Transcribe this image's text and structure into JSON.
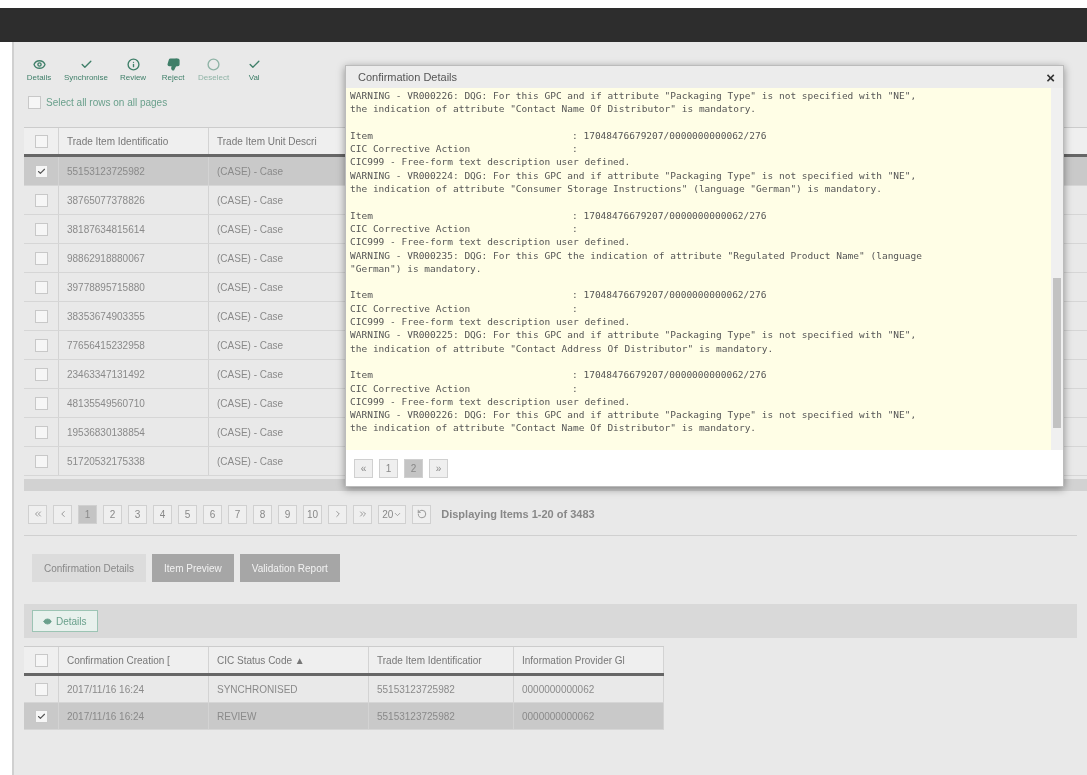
{
  "toolbar": [
    {
      "label": "Details",
      "disabled": false
    },
    {
      "label": "Synchronise",
      "disabled": false
    },
    {
      "label": "Review",
      "disabled": false
    },
    {
      "label": "Reject",
      "disabled": false
    },
    {
      "label": "Deselect",
      "disabled": true
    },
    {
      "label": "Val",
      "disabled": false
    }
  ],
  "select_all": {
    "label": "Select all rows on all pages",
    "checked": false
  },
  "items_table": {
    "header_checked": false,
    "columns": [
      "Trade Item Identificatio",
      "Trade Item Unit Descri"
    ],
    "rows": [
      {
        "cells": [
          "55153123725982",
          "(CASE) - Case"
        ],
        "selected": true
      },
      {
        "cells": [
          "38765077378826",
          "(CASE) - Case"
        ],
        "selected": false
      },
      {
        "cells": [
          "38187634815614",
          "(CASE) - Case"
        ],
        "selected": false
      },
      {
        "cells": [
          "98862918880067",
          "(CASE) - Case"
        ],
        "selected": false
      },
      {
        "cells": [
          "39778895715880",
          "(CASE) - Case"
        ],
        "selected": false
      },
      {
        "cells": [
          "38353674903355",
          "(CASE) - Case"
        ],
        "selected": false
      },
      {
        "cells": [
          "77656415232958",
          "(CASE) - Case"
        ],
        "selected": false
      },
      {
        "cells": [
          "23463347131492",
          "(CASE) - Case"
        ],
        "selected": false
      },
      {
        "cells": [
          "48135549560710",
          "(CASE) - Case"
        ],
        "selected": false
      },
      {
        "cells": [
          "19536830138854",
          "(CASE) - Case"
        ],
        "selected": false
      },
      {
        "cells": [
          "51720532175338",
          "(CASE) - Case"
        ],
        "selected": false
      }
    ]
  },
  "pagination": {
    "pages": [
      {
        "label": "1",
        "selected": true
      },
      {
        "label": "2",
        "selected": false
      },
      {
        "label": "3",
        "selected": false
      },
      {
        "label": "4",
        "selected": false
      },
      {
        "label": "5",
        "selected": false
      },
      {
        "label": "6",
        "selected": false
      },
      {
        "label": "7",
        "selected": false
      },
      {
        "label": "8",
        "selected": false
      },
      {
        "label": "9",
        "selected": false
      },
      {
        "label": "10",
        "selected": false
      }
    ],
    "page_size": "20",
    "status": "Displaying Items 1-20 of 3483"
  },
  "tabs": [
    {
      "label": "Confirmation Details",
      "selected": true
    },
    {
      "label": "Item Preview",
      "selected": false
    },
    {
      "label": "Validation Report",
      "selected": false
    }
  ],
  "details_button": "Details",
  "confirmations_table": {
    "header_checked": false,
    "columns": [
      "Confirmation Creation [",
      "CIC Status Code ▲",
      "Trade Item Identificatior",
      "Information Provider Gl"
    ],
    "rows": [
      {
        "cells": [
          "2017/11/16 16:24",
          "SYNCHRONISED",
          "55153123725982",
          "0000000000062"
        ],
        "selected": false
      },
      {
        "cells": [
          "2017/11/16 16:24",
          "REVIEW",
          "55153123725982",
          "0000000000062"
        ],
        "selected": true
      }
    ]
  },
  "dialog": {
    "title": "Confirmation Details",
    "close": "×",
    "blocks": [
      {
        "lines": [
          "WARNING - VR000226: DQG: For this GPC and if attribute \"Packaging Type\" is not specified with \"NE\",",
          "the indication of attribute \"Contact Name Of Distributor\" is mandatory."
        ]
      },
      {
        "fields": [
          {
            "key": "Item",
            "value": ": 17048476679207/0000000000062/276"
          },
          {
            "key": "CIC Corrective Action",
            "value": ":"
          }
        ],
        "lines": [
          "CIC999 - Free-form text description user defined.",
          "WARNING - VR000224: DQG: For this GPC and if attribute \"Packaging Type\" is not specified with \"NE\",",
          "the indication of attribute \"Consumer Storage Instructions\" (language \"German\") is mandatory."
        ]
      },
      {
        "fields": [
          {
            "key": "Item",
            "value": ": 17048476679207/0000000000062/276"
          },
          {
            "key": "CIC Corrective Action",
            "value": ":"
          }
        ],
        "lines": [
          "CIC999 - Free-form text description user defined.",
          "WARNING - VR000235: DQG: For this GPC the indication of attribute \"Regulated Product Name\" (language",
          "\"German\") is mandatory."
        ]
      },
      {
        "fields": [
          {
            "key": "Item",
            "value": ": 17048476679207/0000000000062/276"
          },
          {
            "key": "CIC Corrective Action",
            "value": ":"
          }
        ],
        "lines": [
          "CIC999 - Free-form text description user defined.",
          "WARNING - VR000225: DQG: For this GPC and if attribute \"Packaging Type\" is not specified with \"NE\",",
          "the indication of attribute \"Contact Address Of Distributor\" is mandatory."
        ]
      },
      {
        "fields": [
          {
            "key": "Item",
            "value": ": 17048476679207/0000000000062/276"
          },
          {
            "key": "CIC Corrective Action",
            "value": ":"
          }
        ],
        "lines": [
          "CIC999 - Free-form text description user defined.",
          "WARNING - VR000226: DQG: For this GPC and if attribute \"Packaging Type\" is not specified with \"NE\",",
          "the indication of attribute \"Contact Name Of Distributor\" is mandatory."
        ]
      }
    ],
    "pager": {
      "prev": "«",
      "pages": [
        {
          "label": "1",
          "selected": false
        },
        {
          "label": "2",
          "selected": true
        }
      ],
      "next": "»"
    }
  }
}
